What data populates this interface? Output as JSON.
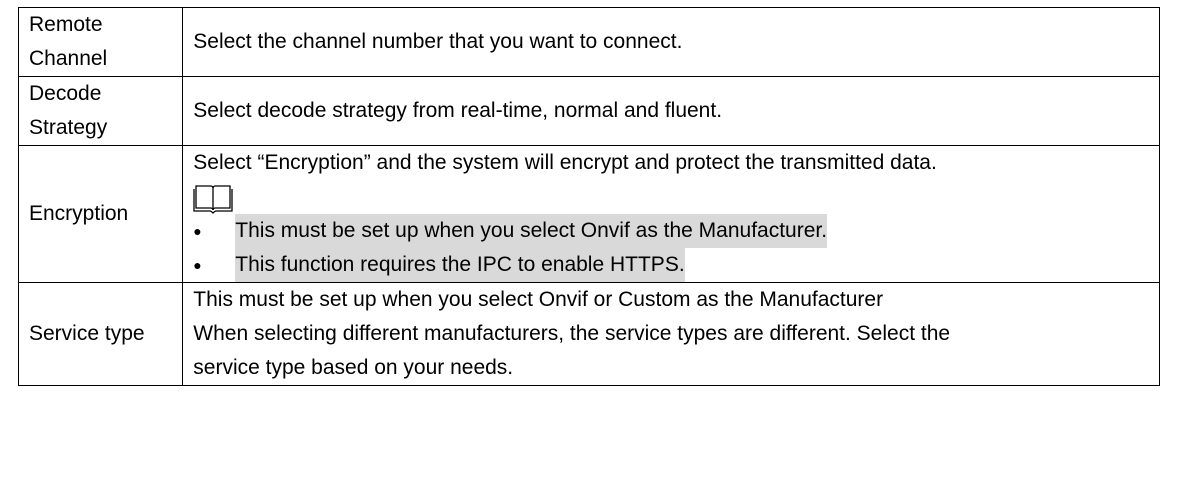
{
  "rows": [
    {
      "name_lines": [
        "Remote",
        "Channel"
      ],
      "description": "Select the channel number that you want to connect."
    },
    {
      "name_lines": [
        "Decode",
        "Strategy"
      ],
      "description": "Select decode strategy from real-time, normal and fluent."
    },
    {
      "name": "Encryption",
      "description": "Select “Encryption” and the system will encrypt and protect the transmitted data.",
      "note_icon": "book-note-icon",
      "bullets": [
        "This must be set up when you select Onvif as the Manufacturer.",
        "This function requires the IPC to enable HTTPS."
      ]
    },
    {
      "name": "Service type",
      "description_lines": [
        "This must be set up when you select Onvif or Custom as the Manufacturer",
        "When selecting different manufacturers, the service types are different. Select the",
        "service type based on your needs."
      ]
    }
  ],
  "bullet_glyph": "●",
  "colors": {
    "border": "#000000",
    "highlight": "#d9d9d9"
  }
}
